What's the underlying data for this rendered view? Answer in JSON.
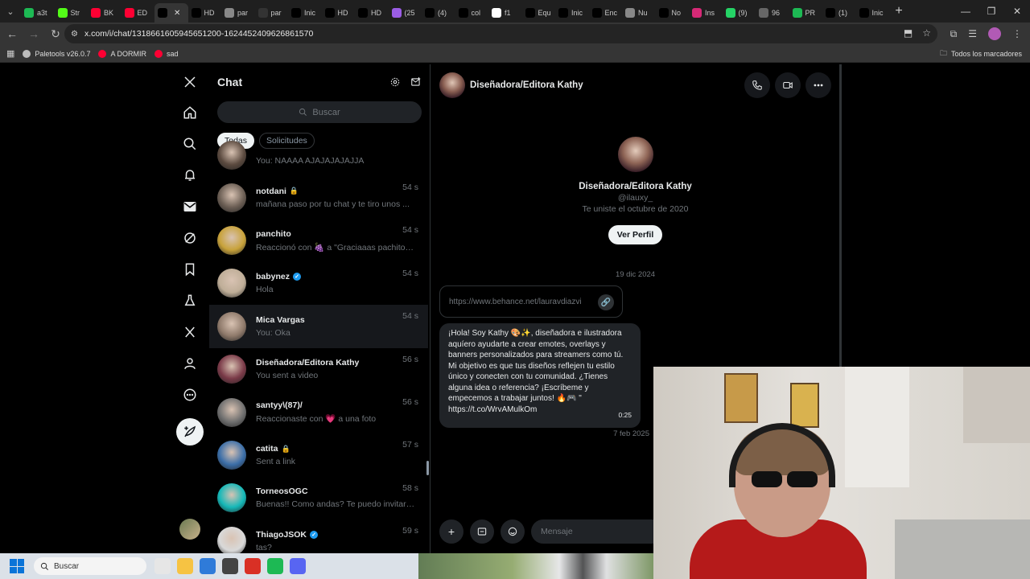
{
  "browser": {
    "tabs": [
      {
        "label": "a3t",
        "color": "#1db954"
      },
      {
        "label": "Str",
        "color": "#53fc18"
      },
      {
        "label": "BK",
        "color": "#ff0033"
      },
      {
        "label": "ED",
        "color": "#ff0033"
      },
      {
        "label": "",
        "color": "#000000",
        "active": true
      },
      {
        "label": "HD",
        "color": "#000000"
      },
      {
        "label": "par",
        "color": "#888888"
      },
      {
        "label": "par",
        "color": "#333333"
      },
      {
        "label": "Inic",
        "color": "#000000"
      },
      {
        "label": "HD",
        "color": "#000000"
      },
      {
        "label": "HD",
        "color": "#000000"
      },
      {
        "label": "(25",
        "color": "#9b5de5"
      },
      {
        "label": "(4)",
        "color": "#010101"
      },
      {
        "label": "col",
        "color": "#000000"
      },
      {
        "label": "f1",
        "color": "#ffffff"
      },
      {
        "label": "Equ",
        "color": "#000000"
      },
      {
        "label": "Inic",
        "color": "#000000"
      },
      {
        "label": "Enc",
        "color": "#010101"
      },
      {
        "label": "Nu",
        "color": "#888888"
      },
      {
        "label": "No",
        "color": "#000000"
      },
      {
        "label": "Ins",
        "color": "#d62976"
      },
      {
        "label": "(9)",
        "color": "#25d366"
      },
      {
        "label": "96",
        "color": "#666666"
      },
      {
        "label": "PR",
        "color": "#1db954"
      },
      {
        "label": "(1)",
        "color": "#000000"
      },
      {
        "label": "Inic",
        "color": "#000000"
      }
    ],
    "url": "x.com/i/chat/1318661605945651200-1624452409626861570",
    "bookmarks": [
      {
        "label": "Paletools v26.0.7",
        "color": "#bbbbbb"
      },
      {
        "label": "A DORMIR",
        "color": "#ff0033"
      },
      {
        "label": "sad",
        "color": "#ff0033"
      }
    ],
    "all_bookmarks": "Todos los marcadores"
  },
  "chat": {
    "title": "Chat",
    "search_placeholder": "Buscar",
    "filters": [
      "Todas",
      "Solicitudes"
    ],
    "conversations": [
      {
        "name": "",
        "preview": "You: NAAAA AJAJAJAJAJJA",
        "time": "",
        "avatar": "#5b4a3f",
        "partial": true
      },
      {
        "name": "notdani",
        "lock": true,
        "preview": "mañana paso por tu chat y te tiro unos ...",
        "time": "54 s",
        "avatar": "#6b5e54"
      },
      {
        "name": "panchito",
        "preview": "Reaccionó con 🍇 a \"Graciaaas pachitooo\"",
        "time": "54 s",
        "avatar": "#c8a23a"
      },
      {
        "name": "babynez",
        "verified": true,
        "preview": "Hola",
        "time": "54 s",
        "avatar": "#bfae98"
      },
      {
        "name": "Mica Vargas",
        "preview": "You: Oka",
        "time": "54 s",
        "avatar": "#8f7a6b",
        "hover": true
      },
      {
        "name": "Diseñadora/Editora Kathy",
        "preview": "You sent a video",
        "time": "56 s",
        "avatar": "#7a3a48"
      },
      {
        "name": "santyy\\(87)/",
        "preview": "Reaccionaste con 💗 a una foto",
        "time": "56 s",
        "avatar": "#6f6f6f"
      },
      {
        "name": "catita",
        "lock": true,
        "preview": "Sent a link",
        "time": "57 s",
        "avatar": "#3b6ea8"
      },
      {
        "name": "TorneosOGC",
        "preview": "Buenas!! Como andas? Te puedo invitar a ...",
        "time": "58 s",
        "avatar": "#14b8b8"
      },
      {
        "name": "ThiagoJSOK",
        "verified": true,
        "preview": "tas?",
        "time": "59 s",
        "avatar": "#d9d9d9"
      }
    ]
  },
  "conversation": {
    "name": "Diseñadora/Editora Kathy",
    "handle": "@ilauxy_",
    "joined": "Te uniste el octubre de 2020",
    "view_profile": "Ver Perfil",
    "date1": "19 dic 2024",
    "link": "https://www.behance.net/lauravdiazvi",
    "message": "¡Hola! Soy Kathy 🎨✨, diseñadora e ilustradora aquíero ayudarte a crear emotes, overlays y banners personalizados para streamers como tú. Mi objetivo es que tus diseños reflejen tu estilo único y conecten con tu comunidad. ¿Tienes alguna idea o referencia? ¡Escríbeme y empecemos a trabajar juntos! 🔥🎮 \" https://t.co/WrvAMulkOm",
    "message_time": "0:25",
    "date2": "7 feb 2025",
    "composer_placeholder": "Mensaje"
  },
  "taskbar": {
    "search_label": "Buscar",
    "apps": [
      "#e6e6e6",
      "#f6c343",
      "#2f7bd9",
      "#444444",
      "#d93025",
      "#1db954",
      "#5865f2"
    ]
  }
}
